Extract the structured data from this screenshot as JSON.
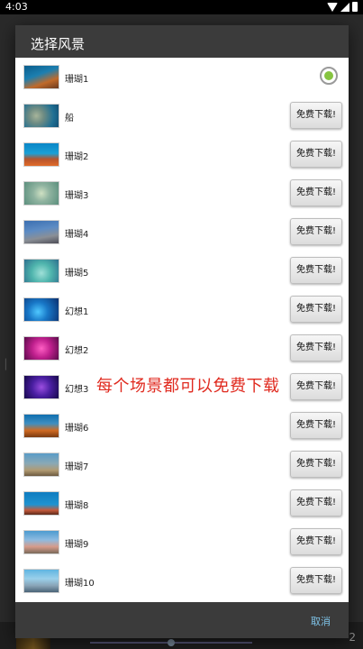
{
  "status_bar": {
    "time": "4:03"
  },
  "dialog": {
    "title": "选择风景",
    "cancel_label": "取消",
    "download_label": "免费下载!",
    "items": [
      {
        "label": "珊瑚1",
        "thumb": "t-reef1",
        "selected": true
      },
      {
        "label": "船",
        "thumb": "t-ship"
      },
      {
        "label": "珊瑚2",
        "thumb": "t-reef2"
      },
      {
        "label": "珊瑚3",
        "thumb": "t-reef3"
      },
      {
        "label": "珊瑚4",
        "thumb": "t-reef4"
      },
      {
        "label": "珊瑚5",
        "thumb": "t-reef5"
      },
      {
        "label": "幻想1",
        "thumb": "t-fant1"
      },
      {
        "label": "幻想2",
        "thumb": "t-fant2"
      },
      {
        "label": "幻想3",
        "thumb": "t-fant3"
      },
      {
        "label": "珊瑚6",
        "thumb": "t-reef6"
      },
      {
        "label": "珊瑚7",
        "thumb": "t-reef7"
      },
      {
        "label": "珊瑚8",
        "thumb": "t-reef8"
      },
      {
        "label": "珊瑚9",
        "thumb": "t-reef9"
      },
      {
        "label": "珊瑚10",
        "thumb": "t-reef10"
      }
    ]
  },
  "annotation": "每个场景都可以免费下载",
  "background": {
    "counter": "2"
  },
  "colors": {
    "radio_selected": "#86c440",
    "annotation": "#e02a1f",
    "cancel": "#7fc3e8"
  }
}
